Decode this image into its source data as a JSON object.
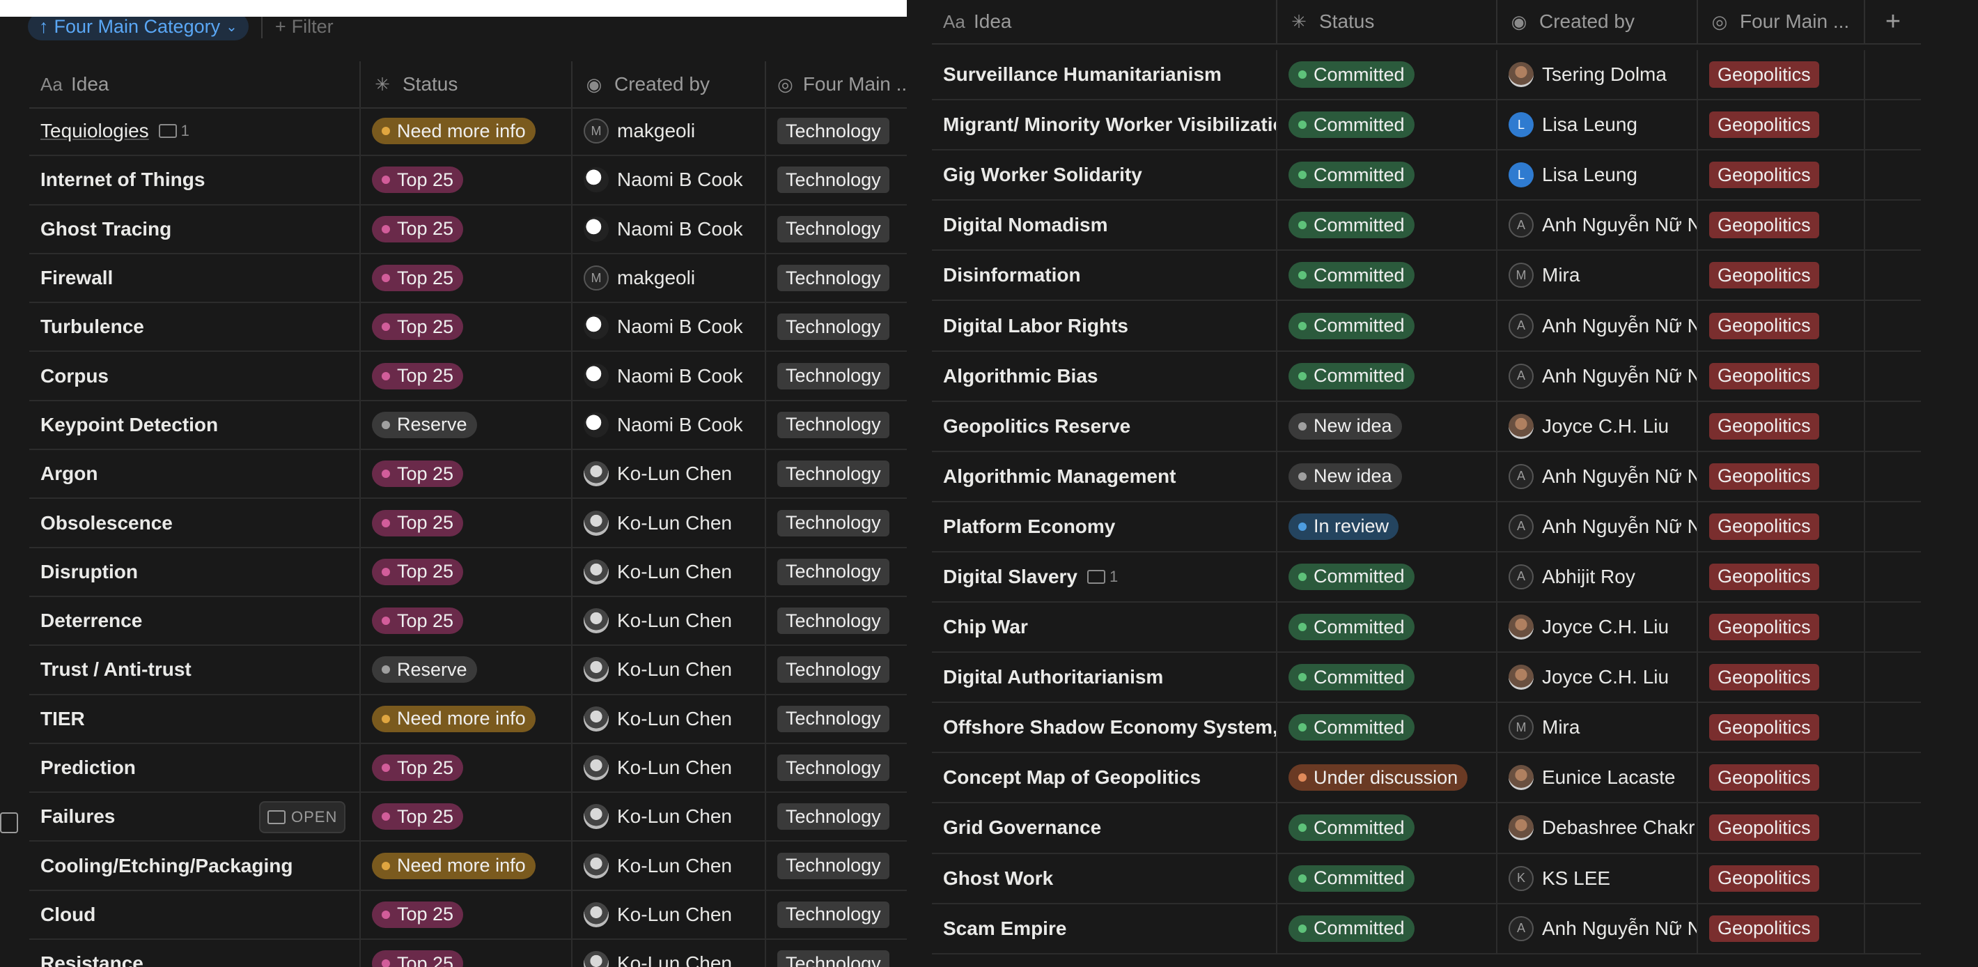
{
  "colors": {
    "need_more_info": "#7a5a1e",
    "need_more_info_dot": "#e0a640",
    "top25": "#6a2a4a",
    "top25_dot": "#d25d9a",
    "reserve": "#3a3a3a",
    "reserve_dot": "#a0a0a0",
    "committed": "#2b5a3c",
    "committed_dot": "#5ec27a",
    "new_idea": "#3a3a3a",
    "new_idea_dot": "#a0a0a0",
    "in_review": "#24445f",
    "in_review_dot": "#4d9de0",
    "under_discussion": "#6a3a24",
    "under_discussion_dot": "#e08a5a",
    "tag_technology": "#3a3a3a",
    "tag_geopolitics": "#7a2e2e",
    "sort_accent": "#5aa7f5"
  },
  "left": {
    "toolbar": {
      "sort_label": "Four Main Category",
      "filter_label": "Filter"
    },
    "headers": {
      "idea": "Idea",
      "status": "Status",
      "created_by": "Created by",
      "category": "Four Main ..."
    },
    "open_label": "OPEN",
    "rows": [
      {
        "title": "Tequiologies",
        "plain": true,
        "comments": "1",
        "status": "Need more info",
        "status_key": "need_more_info",
        "creator": "makgeoli",
        "avatar": "letter",
        "initial": "M",
        "category": "Technology"
      },
      {
        "title": "Internet of Things",
        "status": "Top 25",
        "status_key": "top25",
        "creator": "Naomi B Cook",
        "avatar": "img-a",
        "category": "Technology"
      },
      {
        "title": "Ghost Tracing",
        "status": "Top 25",
        "status_key": "top25",
        "creator": "Naomi B Cook",
        "avatar": "img-a",
        "category": "Technology"
      },
      {
        "title": "Firewall",
        "status": "Top 25",
        "status_key": "top25",
        "creator": "makgeoli",
        "avatar": "letter",
        "initial": "M",
        "category": "Technology"
      },
      {
        "title": "Turbulence",
        "status": "Top 25",
        "status_key": "top25",
        "creator": "Naomi B Cook",
        "avatar": "img-a",
        "category": "Technology"
      },
      {
        "title": "Corpus",
        "status": "Top 25",
        "status_key": "top25",
        "creator": "Naomi B Cook",
        "avatar": "img-a",
        "category": "Technology"
      },
      {
        "title": "Keypoint Detection",
        "status": "Reserve",
        "status_key": "reserve",
        "creator": "Naomi B Cook",
        "avatar": "img-a",
        "category": "Technology"
      },
      {
        "title": "Argon",
        "status": "Top 25",
        "status_key": "top25",
        "creator": "Ko-Lun Chen",
        "avatar": "img-b",
        "category": "Technology"
      },
      {
        "title": "Obsolescence",
        "status": "Top 25",
        "status_key": "top25",
        "creator": "Ko-Lun Chen",
        "avatar": "img-b",
        "category": "Technology"
      },
      {
        "title": "Disruption",
        "status": "Top 25",
        "status_key": "top25",
        "creator": "Ko-Lun Chen",
        "avatar": "img-b",
        "category": "Technology"
      },
      {
        "title": "Deterrence",
        "status": "Top 25",
        "status_key": "top25",
        "creator": "Ko-Lun Chen",
        "avatar": "img-b",
        "category": "Technology"
      },
      {
        "title": "Trust / Anti-trust",
        "status": "Reserve",
        "status_key": "reserve",
        "creator": "Ko-Lun Chen",
        "avatar": "img-b",
        "category": "Technology"
      },
      {
        "title": "TIER",
        "status": "Need more info",
        "status_key": "need_more_info",
        "creator": "Ko-Lun Chen",
        "avatar": "img-b",
        "category": "Technology"
      },
      {
        "title": "Prediction",
        "status": "Top 25",
        "status_key": "top25",
        "creator": "Ko-Lun Chen",
        "avatar": "img-b",
        "category": "Technology"
      },
      {
        "title": "Failures",
        "status": "Top 25",
        "status_key": "top25",
        "creator": "Ko-Lun Chen",
        "avatar": "img-b",
        "category": "Technology",
        "hover": true
      },
      {
        "title": "Cooling/Etching/Packaging",
        "status": "Need more info",
        "status_key": "need_more_info",
        "creator": "Ko-Lun Chen",
        "avatar": "img-b",
        "category": "Technology"
      },
      {
        "title": "Cloud",
        "status": "Top 25",
        "status_key": "top25",
        "creator": "Ko-Lun Chen",
        "avatar": "img-b",
        "category": "Technology"
      },
      {
        "title": "Resistance",
        "status": "Top 25",
        "status_key": "top25",
        "creator": "Ko-Lun Chen",
        "avatar": "img-b",
        "category": "Technology"
      }
    ]
  },
  "right": {
    "headers": {
      "idea": "Idea",
      "status": "Status",
      "created_by": "Created by",
      "category": "Four Main ..."
    },
    "rows": [
      {
        "title": "Surveillance Humanitarianism",
        "status": "Committed",
        "status_key": "committed",
        "creator": "Tsering Dolma",
        "avatar": "photo",
        "category": "Geopolitics"
      },
      {
        "title": "Migrant/ Minority Worker Visibilization",
        "status": "Committed",
        "status_key": "committed",
        "creator": "Lisa Leung",
        "avatar": "blue",
        "initial": "L",
        "category": "Geopolitics"
      },
      {
        "title": "Gig Worker Solidarity",
        "status": "Committed",
        "status_key": "committed",
        "creator": "Lisa Leung",
        "avatar": "blue",
        "initial": "L",
        "category": "Geopolitics"
      },
      {
        "title": "Digital Nomadism",
        "status": "Committed",
        "status_key": "committed",
        "creator": "Anh Nguyễn Nữ N",
        "avatar": "letter",
        "initial": "A",
        "category": "Geopolitics"
      },
      {
        "title": "Disinformation",
        "status": "Committed",
        "status_key": "committed",
        "creator": "Mira",
        "avatar": "letter",
        "initial": "M",
        "category": "Geopolitics"
      },
      {
        "title": "Digital Labor Rights",
        "status": "Committed",
        "status_key": "committed",
        "creator": "Anh Nguyễn Nữ N",
        "avatar": "letter",
        "initial": "A",
        "category": "Geopolitics"
      },
      {
        "title": "Algorithmic Bias",
        "status": "Committed",
        "status_key": "committed",
        "creator": "Anh Nguyễn Nữ N",
        "avatar": "letter",
        "initial": "A",
        "category": "Geopolitics"
      },
      {
        "title": "Geopolitics Reserve",
        "status": "New idea",
        "status_key": "new_idea",
        "creator": "Joyce C.H. Liu",
        "avatar": "photo",
        "category": "Geopolitics"
      },
      {
        "title": "Algorithmic Management",
        "status": "New idea",
        "status_key": "new_idea",
        "creator": "Anh Nguyễn Nữ N",
        "avatar": "letter",
        "initial": "A",
        "category": "Geopolitics"
      },
      {
        "title": "Platform Economy",
        "status": "In review",
        "status_key": "in_review",
        "creator": "Anh Nguyễn Nữ N",
        "avatar": "letter",
        "initial": "A",
        "category": "Geopolitics"
      },
      {
        "title": "Digital Slavery",
        "comments": "1",
        "status": "Committed",
        "status_key": "committed",
        "creator": "Abhijit Roy",
        "avatar": "letter",
        "initial": "A",
        "category": "Geopolitics"
      },
      {
        "title": "Chip War",
        "status": "Committed",
        "status_key": "committed",
        "creator": "Joyce C.H. Liu",
        "avatar": "photo",
        "category": "Geopolitics"
      },
      {
        "title": "Digital Authoritarianism",
        "status": "Committed",
        "status_key": "committed",
        "creator": "Joyce C.H. Liu",
        "avatar": "photo",
        "category": "Geopolitics"
      },
      {
        "title": "Offshore Shadow Economy System, c",
        "status": "Committed",
        "status_key": "committed",
        "creator": "Mira",
        "avatar": "letter",
        "initial": "M",
        "category": "Geopolitics"
      },
      {
        "title": "Concept Map of Geopolitics",
        "status": "Under discussion",
        "status_key": "under_discussion",
        "creator": "Eunice Lacaste",
        "avatar": "photo",
        "category": "Geopolitics"
      },
      {
        "title": "Grid Governance",
        "status": "Committed",
        "status_key": "committed",
        "creator": "Debashree Chakr",
        "avatar": "photo",
        "category": "Geopolitics"
      },
      {
        "title": "Ghost Work",
        "status": "Committed",
        "status_key": "committed",
        "creator": "KS LEE",
        "avatar": "letter",
        "initial": "K",
        "category": "Geopolitics"
      },
      {
        "title": "Scam Empire",
        "status": "Committed",
        "status_key": "committed",
        "creator": "Anh Nguyễn Nữ N",
        "avatar": "letter",
        "initial": "A",
        "category": "Geopolitics"
      }
    ]
  }
}
